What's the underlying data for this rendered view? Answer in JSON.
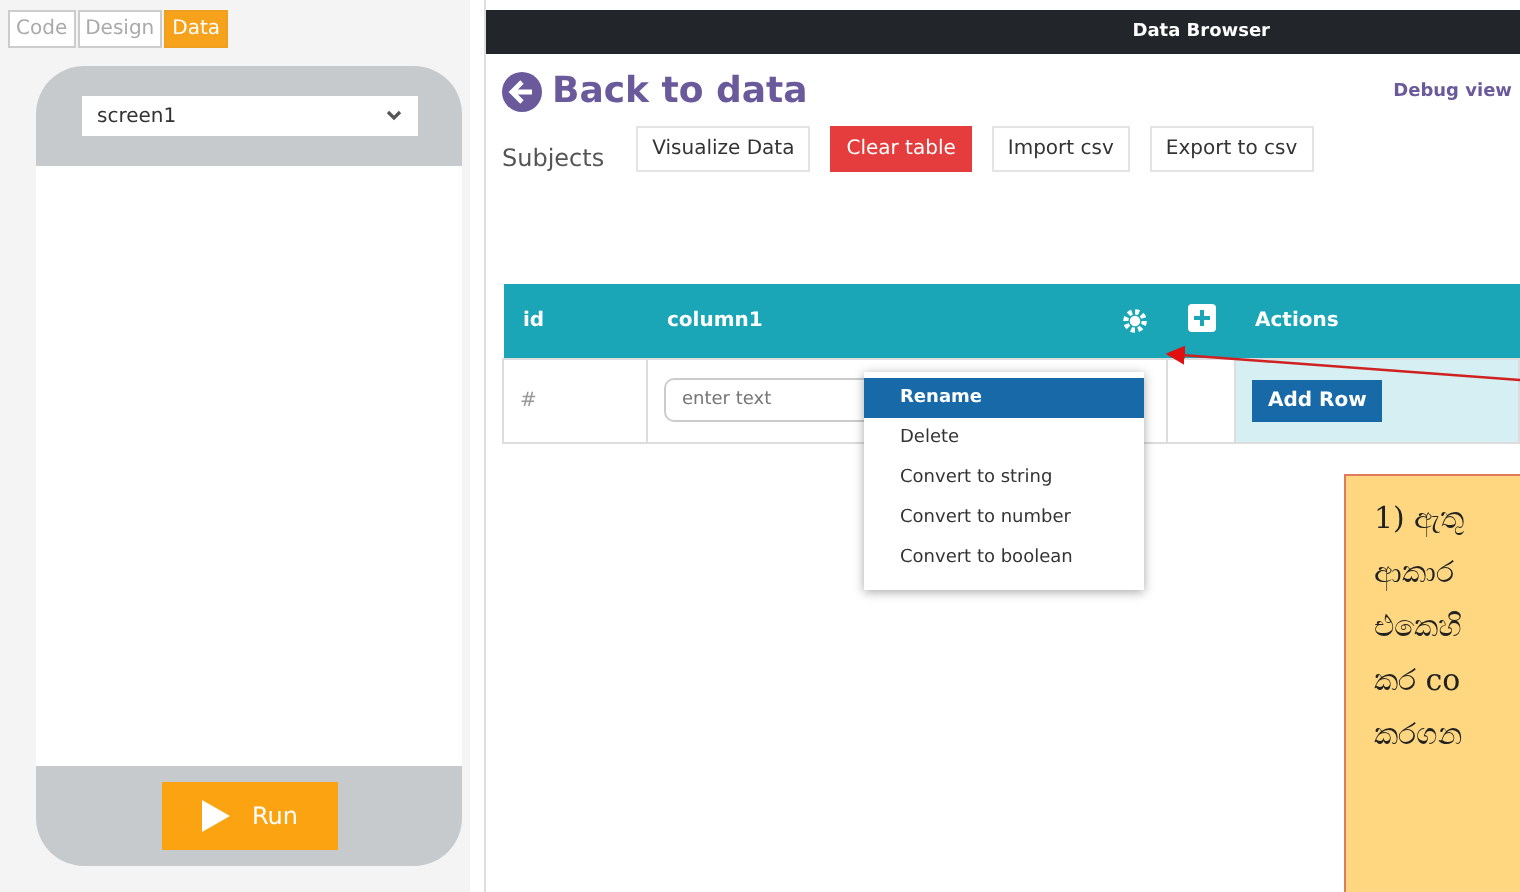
{
  "side_tabs": [
    {
      "label": "Code",
      "selected": false
    },
    {
      "label": "Design",
      "selected": false
    },
    {
      "label": "Data",
      "selected": true
    }
  ],
  "screen_select": {
    "value": "screen1"
  },
  "run_button": {
    "label": "Run"
  },
  "window": {
    "title": "Data Browser"
  },
  "back_link": "Back to data",
  "debug_link": "Debug view",
  "table_name": "Subjects",
  "toolbar_buttons": [
    {
      "label": "Visualize Data",
      "kind": "plain"
    },
    {
      "label": "Clear table",
      "kind": "danger"
    },
    {
      "label": "Import csv",
      "kind": "plain"
    },
    {
      "label": "Export to csv",
      "kind": "plain"
    }
  ],
  "table": {
    "columns": [
      "id",
      "column1",
      "Actions"
    ],
    "new_row": {
      "id": "#",
      "placeholder": "enter text",
      "action": "Add Row"
    }
  },
  "column_menu": [
    {
      "label": "Rename",
      "selected": true
    },
    {
      "label": "Delete",
      "selected": false
    },
    {
      "label": "Convert to string",
      "selected": false
    },
    {
      "label": "Convert to number",
      "selected": false
    },
    {
      "label": "Convert to boolean",
      "selected": false
    }
  ],
  "callout": {
    "lines": [
      "1) ඇතු",
      "ආකාර",
      "එකෙහි",
      "කර co",
      "කරගන"
    ]
  }
}
